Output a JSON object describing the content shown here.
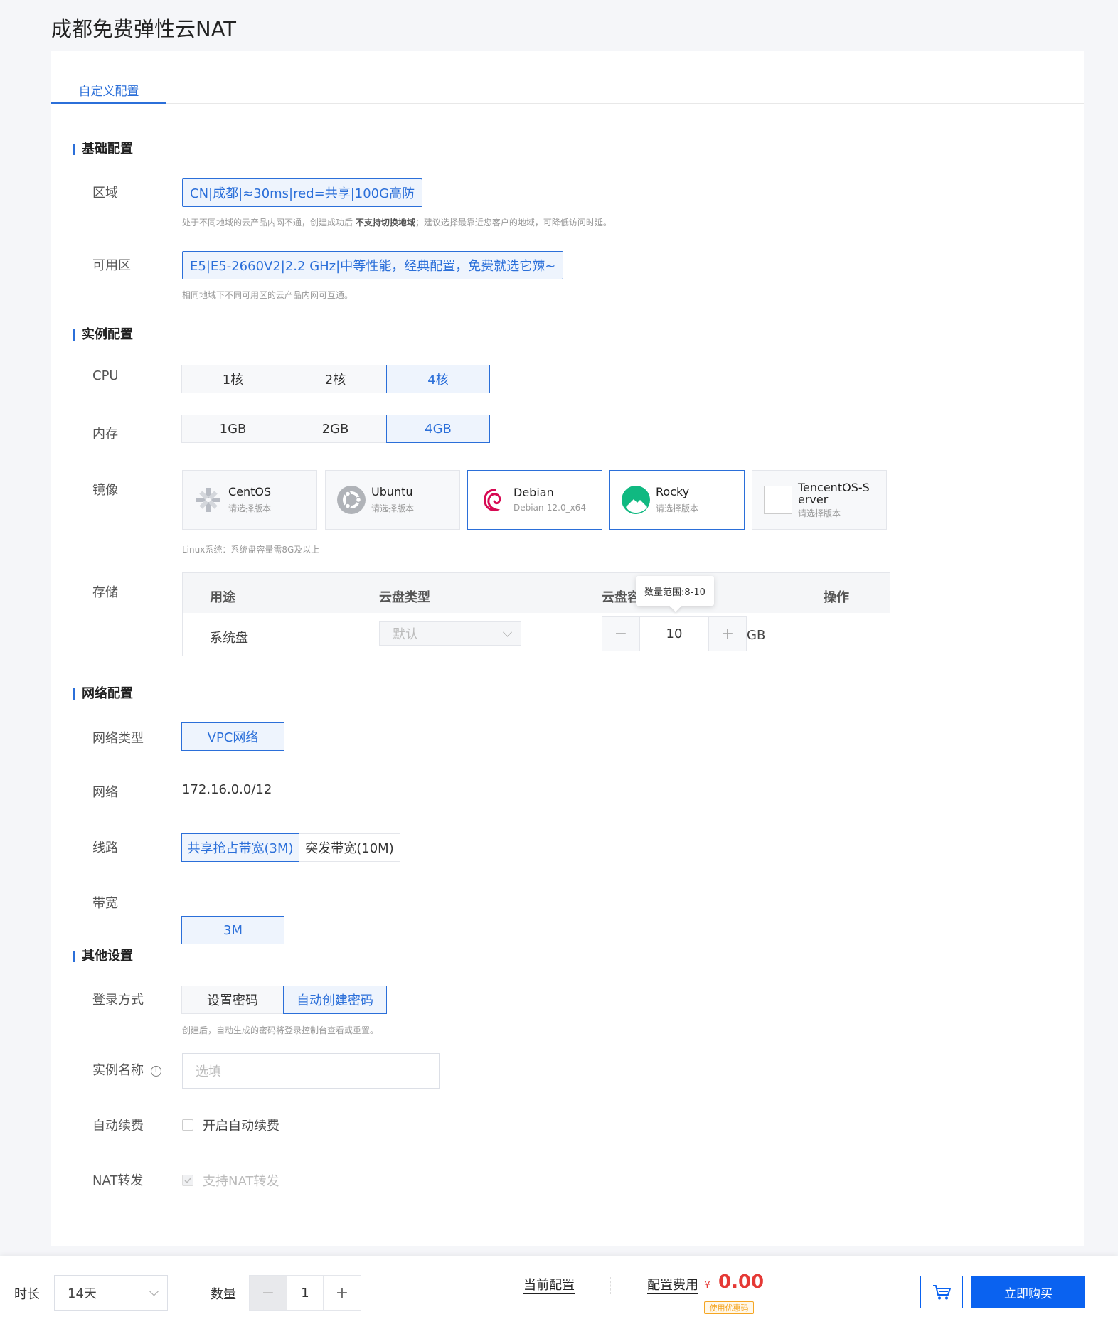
{
  "page": {
    "title": "成都免费弹性云NAT"
  },
  "tabs": [
    {
      "label": "自定义配置"
    }
  ],
  "sections": {
    "basic": "基础配置",
    "instance": "实例配置",
    "network": "网络配置",
    "other": "其他设置"
  },
  "region": {
    "label": "区域",
    "value": "CN|成都|≈30ms|red=共享|100G高防",
    "hint_prefix": "处于不同地域的云产品内网不通，创建成功后 ",
    "hint_bold": "不支持切换地域",
    "hint_suffix": "；建议选择最靠近您客户的地域，可降低访问时延。"
  },
  "zone": {
    "label": "可用区",
    "value": "E5|E5-2660V2|2.2 GHz|中等性能，经典配置，免费就选它辣~",
    "hint": "相同地域下不同可用区的云产品内网可互通。"
  },
  "cpu": {
    "label": "CPU",
    "options": [
      "1核",
      "2核",
      "4核"
    ],
    "selected": "4核"
  },
  "memory": {
    "label": "内存",
    "options": [
      "1GB",
      "2GB",
      "4GB"
    ],
    "selected": "4GB"
  },
  "image": {
    "label": "镜像",
    "options": [
      {
        "name": "CentOS",
        "sub": "请选择版本",
        "icon": "centos-icon",
        "selected": false
      },
      {
        "name": "Ubuntu",
        "sub": "请选择版本",
        "icon": "ubuntu-icon",
        "selected": false
      },
      {
        "name": "Debian",
        "sub": "Debian-12.0_x64",
        "icon": "debian-icon",
        "selected": true
      },
      {
        "name": "Rocky",
        "sub": "请选择版本",
        "icon": "rocky-icon",
        "selected": false
      },
      {
        "name": "TencentOS-Server",
        "sub": "请选择版本",
        "icon": "broken-image-icon",
        "selected": false
      }
    ],
    "hint": "Linux系统：系统盘容量需8G及以上"
  },
  "storage": {
    "label": "存储",
    "columns": [
      "用途",
      "云盘类型",
      "云盘容",
      "操作"
    ],
    "row": {
      "usage": "系统盘",
      "type_placeholder": "默认",
      "capacity": "10",
      "unit": "GB"
    },
    "tooltip": "数量范围:8-10"
  },
  "network_type": {
    "label": "网络类型",
    "value": "VPC网络"
  },
  "network": {
    "label": "网络",
    "value": "172.16.0.0/12"
  },
  "line": {
    "label": "线路",
    "options": [
      "共享抢占带宽(3M)",
      "突发带宽(10M)"
    ],
    "selected": "共享抢占带宽(3M)"
  },
  "bandwidth": {
    "label": "带宽",
    "value": "3M"
  },
  "login": {
    "label": "登录方式",
    "options": [
      "设置密码",
      "自动创建密码"
    ],
    "selected": "自动创建密码",
    "hint": "创建后，自动生成的密码将登录控制台查看或重置。"
  },
  "instance_name": {
    "label": "实例名称",
    "placeholder": "选填"
  },
  "auto_renew": {
    "label": "自动续费",
    "checkbox_label": "开启自动续费",
    "checked": false
  },
  "nat": {
    "label": "NAT转发",
    "checkbox_label": "支持NAT转发",
    "checked": true,
    "disabled": true
  },
  "bottom": {
    "duration_label": "时长",
    "duration_value": "14天",
    "quantity_label": "数量",
    "quantity_value": "1",
    "current_config": "当前配置",
    "fee_label": "配置费用",
    "currency": "¥",
    "price": "0.00",
    "coupon": "使用优惠码",
    "buy_now": "立即购买"
  },
  "colors": {
    "accent": "#2b6fd9",
    "buy_button": "#0a62f0",
    "price": "#e53935",
    "coupon": "#f5a623"
  }
}
